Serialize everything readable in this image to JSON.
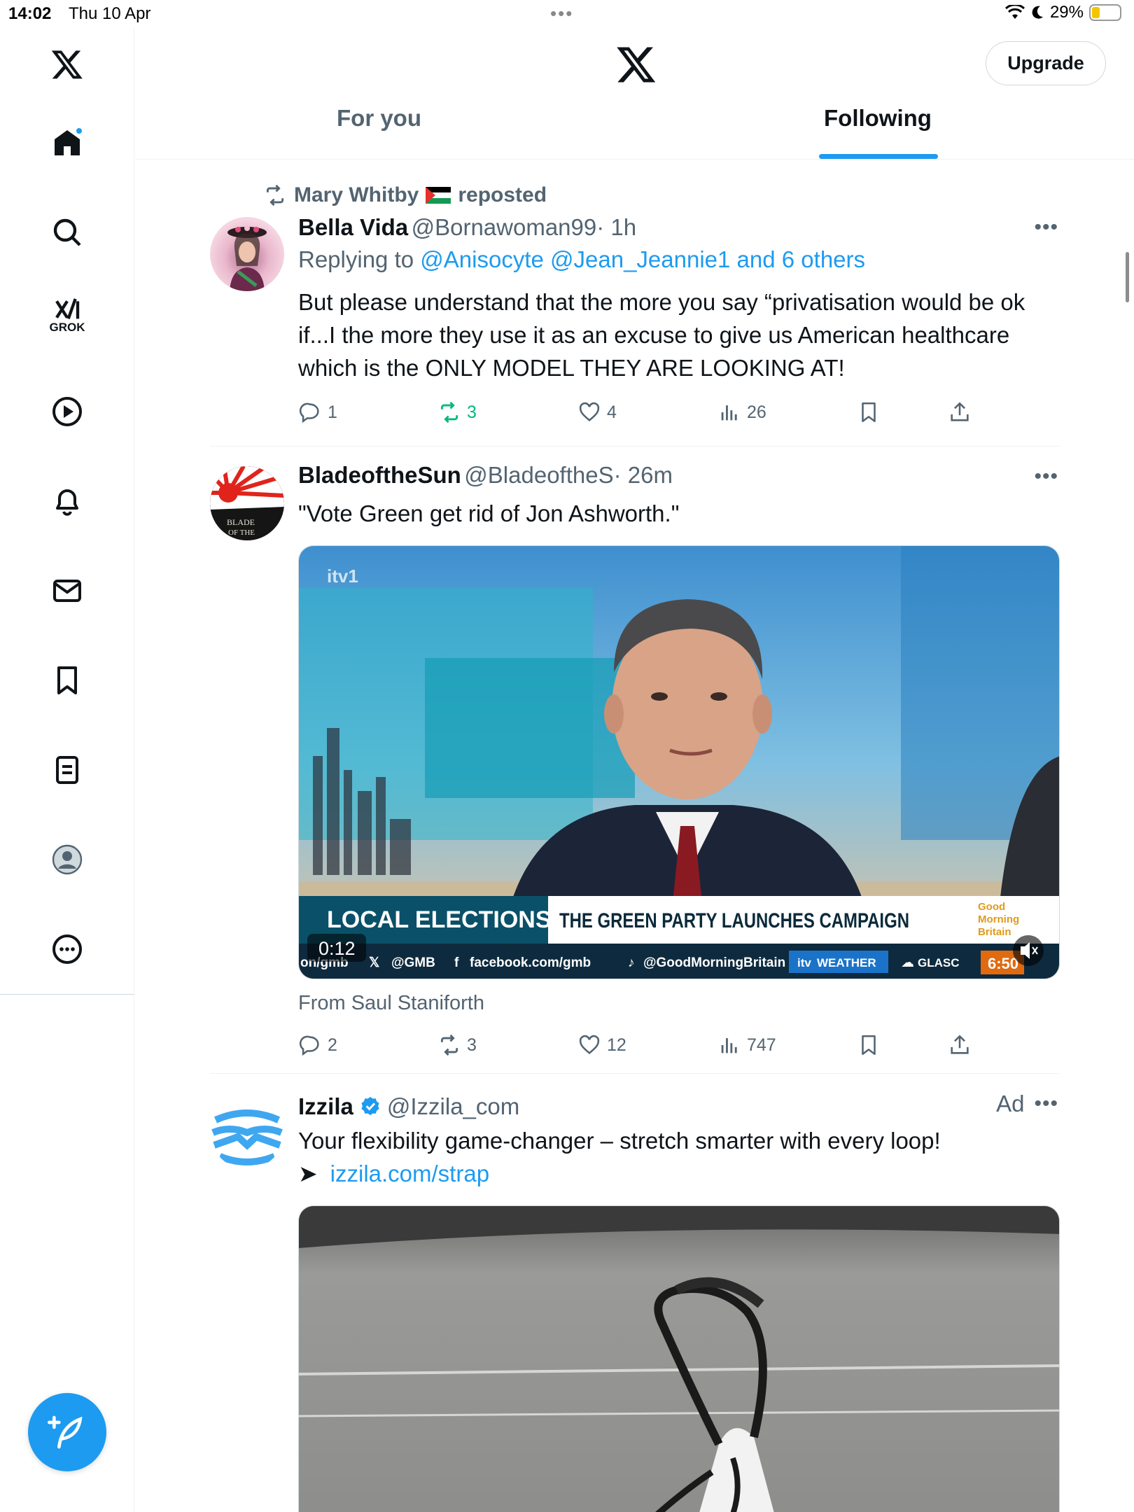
{
  "status_bar": {
    "time": "14:02",
    "date": "Thu 10 Apr",
    "battery": "29%",
    "battery_level": 0.29
  },
  "header": {
    "upgrade_label": "Upgrade",
    "tabs": [
      {
        "label": "For you"
      },
      {
        "label": "Following"
      }
    ]
  },
  "sidebar": {
    "items": [
      {
        "icon": "x-logo-icon"
      },
      {
        "icon": "home-icon"
      },
      {
        "icon": "search-icon"
      },
      {
        "icon": "grok-icon",
        "label": "GROK"
      },
      {
        "icon": "video-icon"
      },
      {
        "icon": "notifications-icon"
      },
      {
        "icon": "messages-icon"
      },
      {
        "icon": "bookmarks-icon"
      },
      {
        "icon": "lists-icon"
      },
      {
        "icon": "profile-icon"
      },
      {
        "icon": "more-icon"
      }
    ],
    "compose_icon": "compose-icon"
  },
  "posts": [
    {
      "repost_by": "Mary Whitby",
      "repost_label": "reposted",
      "name": "Bella Vida",
      "handle": "@Bornawoman99",
      "time": "· 1h",
      "reply_prefix": "Replying to",
      "reply_to": "@Anisocyte @Jean_Jeannie1 and 6 others",
      "text": "But please understand that the more you say “privatisation would be ok if...I the more they use it as an excuse to give us American healthcare which is the ONLY MODEL THEY ARE LOOKING AT!",
      "replies": "1",
      "reposts": "3",
      "likes": "4",
      "views": "26"
    },
    {
      "name": "BladeoftheSun",
      "handle": "@BladeoftheS",
      "time": "· 26m",
      "text": "\"Vote Green get rid of Jon Ashworth.\"",
      "video": {
        "channel": "itv1",
        "banner_left": "LOCAL ELECTIONS",
        "banner_right": "THE GREEN PARTY LAUNCHES CAMPAIGN",
        "brand": "Good Morning Britain",
        "ticker": [
          "on/gmb",
          "@GMB",
          "facebook.com/gmb",
          "@GoodMorningBritain",
          "WEATHER",
          "GLASC"
        ],
        "clock": "6:50",
        "duration": "0:12"
      },
      "from": "From Saul Staniforth",
      "replies": "2",
      "reposts": "3",
      "likes": "12",
      "views": "747"
    },
    {
      "name": "Izzila",
      "handle": "@Izzila_com",
      "ad_label": "Ad",
      "text": "Your flexibility game-changer – stretch smarter with every loop!",
      "arrow": "➤",
      "link": "izzila.com/strap"
    }
  ]
}
